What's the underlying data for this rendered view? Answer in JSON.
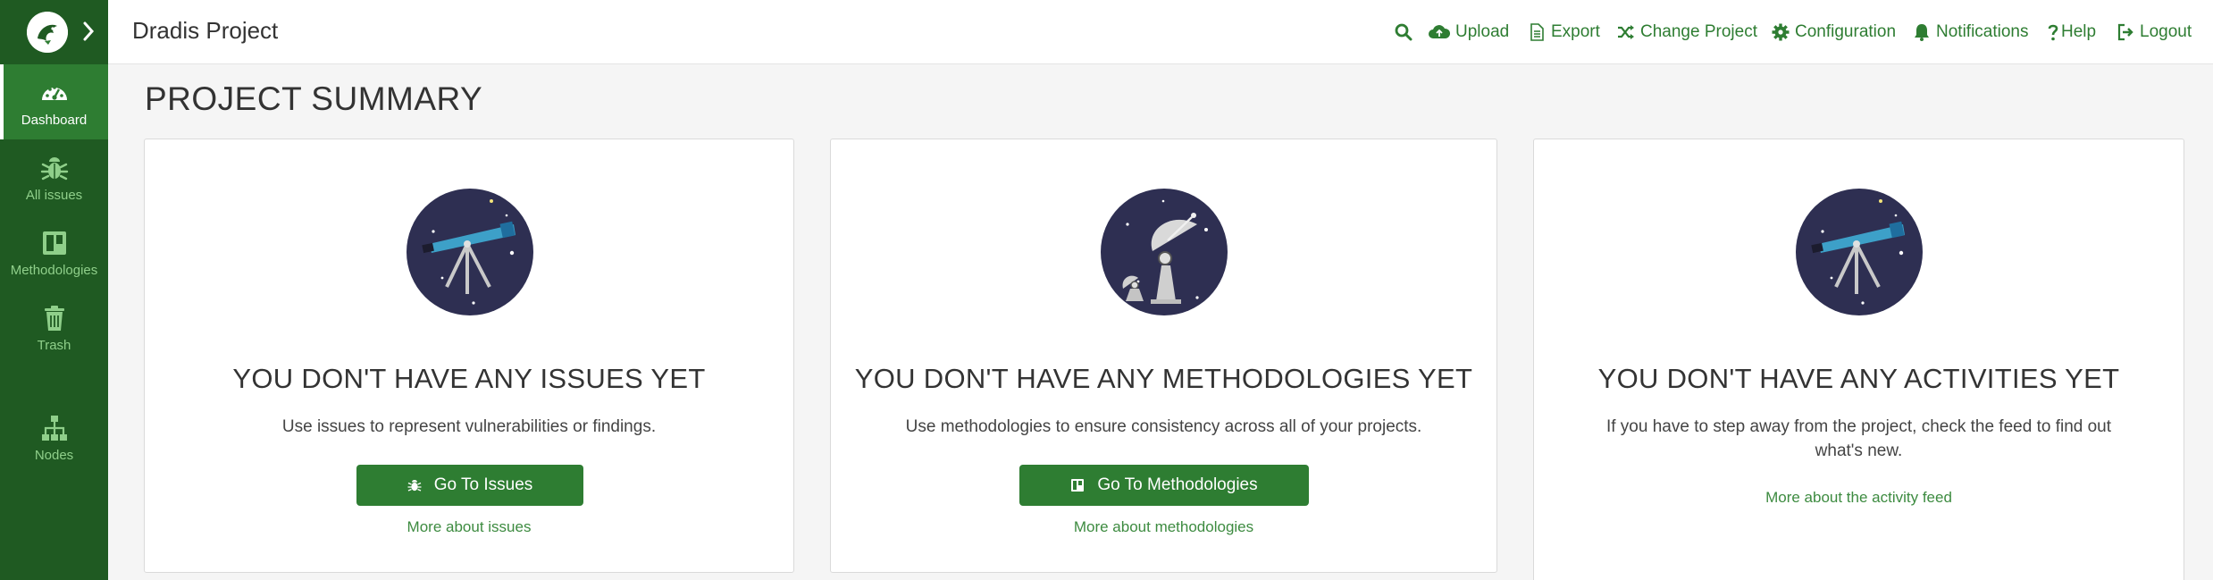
{
  "header": {
    "project_title": "Dradis Project",
    "nav": {
      "upload": "Upload",
      "export": "Export",
      "change_project": "Change Project",
      "configuration": "Configuration",
      "notifications": "Notifications",
      "help": "Help",
      "logout": "Logout"
    }
  },
  "sidebar": {
    "items": [
      {
        "label": "Dashboard",
        "icon": "dashboard-icon"
      },
      {
        "label": "All issues",
        "icon": "bug-icon"
      },
      {
        "label": "Methodologies",
        "icon": "board-icon"
      },
      {
        "label": "Trash",
        "icon": "trash-icon"
      },
      {
        "label": "Nodes",
        "icon": "sitemap-icon"
      }
    ]
  },
  "page": {
    "title": "PROJECT SUMMARY"
  },
  "cards": {
    "issues": {
      "heading": "YOU DON'T HAVE ANY ISSUES YET",
      "description": "Use issues to represent vulnerabilities or findings.",
      "button": "Go To Issues",
      "more_link": "More about issues"
    },
    "methodologies": {
      "heading": "YOU DON'T HAVE ANY METHODOLOGIES YET",
      "description": "Use methodologies to ensure consistency across all of your projects.",
      "button": "Go To Methodologies",
      "more_link": "More about methodologies"
    },
    "activities": {
      "heading": "YOU DON'T HAVE ANY ACTIVITIES YET",
      "description": "If you have to step away from the project, check the feed to find out what's new.",
      "more_link": "More about the activity feed"
    }
  },
  "colors": {
    "sidebar_bg": "#1f5a22",
    "sidebar_active": "#2e7d32",
    "accent": "#2e7d32",
    "illustration_bg": "#2e2f52"
  }
}
